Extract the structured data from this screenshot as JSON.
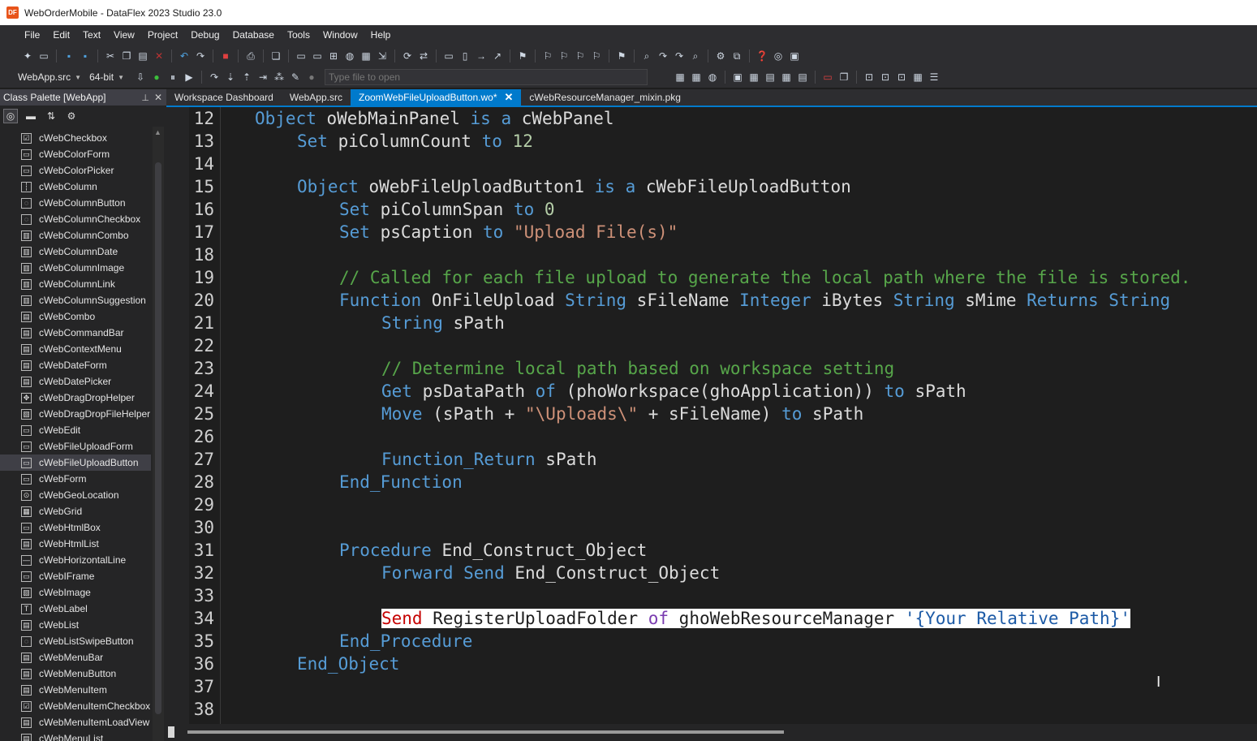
{
  "window": {
    "title": "WebOrderMobile - DataFlex 2023 Studio 23.0",
    "app_icon": "DF"
  },
  "menu": [
    "File",
    "Edit",
    "Text",
    "View",
    "Project",
    "Debug",
    "Database",
    "Tools",
    "Window",
    "Help"
  ],
  "toolbar": {
    "project_select": "WebApp.src",
    "bitness_select": "64-bit",
    "open_file_placeholder": "Type file to open"
  },
  "palette": {
    "title": "Class Palette [WebApp]",
    "selected": "cWebFileUploadButton",
    "items": [
      {
        "label": "cWebCheckbox",
        "icon": "checkbox-icon"
      },
      {
        "label": "cWebColorForm",
        "icon": "color-form-icon"
      },
      {
        "label": "cWebColorPicker",
        "icon": "color-picker-icon"
      },
      {
        "label": "cWebColumn",
        "icon": "column-icon"
      },
      {
        "label": "cWebColumnButton",
        "icon": "column-button-icon"
      },
      {
        "label": "cWebColumnCheckbox",
        "icon": "column-checkbox-icon"
      },
      {
        "label": "cWebColumnCombo",
        "icon": "column-combo-icon"
      },
      {
        "label": "cWebColumnDate",
        "icon": "column-date-icon"
      },
      {
        "label": "cWebColumnImage",
        "icon": "column-image-icon"
      },
      {
        "label": "cWebColumnLink",
        "icon": "column-link-icon"
      },
      {
        "label": "cWebColumnSuggestion",
        "icon": "column-suggestion-icon"
      },
      {
        "label": "cWebCombo",
        "icon": "combo-icon"
      },
      {
        "label": "cWebCommandBar",
        "icon": "commandbar-icon"
      },
      {
        "label": "cWebContextMenu",
        "icon": "context-menu-icon"
      },
      {
        "label": "cWebDateForm",
        "icon": "date-form-icon"
      },
      {
        "label": "cWebDatePicker",
        "icon": "date-picker-icon"
      },
      {
        "label": "cWebDragDropHelper",
        "icon": "drag-drop-icon"
      },
      {
        "label": "cWebDragDropFileHelper",
        "icon": "drag-drop-file-icon"
      },
      {
        "label": "cWebEdit",
        "icon": "edit-icon"
      },
      {
        "label": "cWebFileUploadForm",
        "icon": "file-upload-form-icon"
      },
      {
        "label": "cWebFileUploadButton",
        "icon": "file-upload-button-icon"
      },
      {
        "label": "cWebForm",
        "icon": "form-icon"
      },
      {
        "label": "cWebGeoLocation",
        "icon": "geolocation-icon"
      },
      {
        "label": "cWebGrid",
        "icon": "grid-icon"
      },
      {
        "label": "cWebHtmlBox",
        "icon": "htmlbox-icon"
      },
      {
        "label": "cWebHtmlList",
        "icon": "htmllist-icon"
      },
      {
        "label": "cWebHorizontalLine",
        "icon": "horizontal-line-icon"
      },
      {
        "label": "cWebIFrame",
        "icon": "iframe-icon"
      },
      {
        "label": "cWebImage",
        "icon": "image-icon"
      },
      {
        "label": "cWebLabel",
        "icon": "label-icon"
      },
      {
        "label": "cWebList",
        "icon": "list-icon"
      },
      {
        "label": "cWebListSwipeButton",
        "icon": "list-swipe-icon"
      },
      {
        "label": "cWebMenuBar",
        "icon": "menubar-icon"
      },
      {
        "label": "cWebMenuButton",
        "icon": "menu-button-icon"
      },
      {
        "label": "cWebMenuItem",
        "icon": "menu-item-icon"
      },
      {
        "label": "cWebMenuItemCheckbox",
        "icon": "menu-item-checkbox-icon"
      },
      {
        "label": "cWebMenuItemLoadView",
        "icon": "menu-item-loadview-icon"
      },
      {
        "label": "cWebMenuList",
        "icon": "menu-list-icon"
      }
    ]
  },
  "tabs": [
    {
      "label": "Workspace Dashboard",
      "active": false
    },
    {
      "label": "WebApp.src",
      "active": false
    },
    {
      "label": "ZoomWebFileUploadButton.wo*",
      "active": true
    },
    {
      "label": "cWebResourceManager_mixin.pkg",
      "active": false
    }
  ],
  "editor": {
    "lines": [
      {
        "n": "12",
        "indent": 1,
        "tokens": [
          [
            "kw",
            "Object"
          ],
          [
            "pl",
            " oWebMainPanel "
          ],
          [
            "kw",
            "is a"
          ],
          [
            "pl",
            " cWebPanel"
          ]
        ]
      },
      {
        "n": "13",
        "indent": 2,
        "tokens": [
          [
            "kw",
            "Set"
          ],
          [
            "pl",
            " piColumnCount "
          ],
          [
            "kw",
            "to"
          ],
          [
            "pl",
            " "
          ],
          [
            "nm",
            "12"
          ]
        ]
      },
      {
        "n": "14",
        "indent": 0,
        "tokens": []
      },
      {
        "n": "15",
        "indent": 2,
        "tokens": [
          [
            "kw",
            "Object"
          ],
          [
            "pl",
            " oWebFileUploadButton1 "
          ],
          [
            "kw",
            "is a"
          ],
          [
            "pl",
            " cWebFileUploadButton"
          ]
        ]
      },
      {
        "n": "16",
        "indent": 3,
        "tokens": [
          [
            "kw",
            "Set"
          ],
          [
            "pl",
            " piColumnSpan "
          ],
          [
            "kw",
            "to"
          ],
          [
            "pl",
            " "
          ],
          [
            "nm",
            "0"
          ]
        ]
      },
      {
        "n": "17",
        "indent": 3,
        "tokens": [
          [
            "kw",
            "Set"
          ],
          [
            "pl",
            " psCaption "
          ],
          [
            "kw",
            "to"
          ],
          [
            "pl",
            " "
          ],
          [
            "st",
            "\"Upload File(s)\""
          ]
        ]
      },
      {
        "n": "18",
        "indent": 0,
        "tokens": []
      },
      {
        "n": "19",
        "indent": 3,
        "tokens": [
          [
            "cm",
            "// Called for each file upload to generate the local path where the file is stored."
          ]
        ]
      },
      {
        "n": "20",
        "indent": 3,
        "tokens": [
          [
            "kw",
            "Function"
          ],
          [
            "pl",
            " OnFileUpload "
          ],
          [
            "kw",
            "String"
          ],
          [
            "pl",
            " sFileName "
          ],
          [
            "kw",
            "Integer"
          ],
          [
            "pl",
            " iBytes "
          ],
          [
            "kw",
            "String"
          ],
          [
            "pl",
            " sMime "
          ],
          [
            "kw",
            "Returns String"
          ]
        ]
      },
      {
        "n": "21",
        "indent": 4,
        "tokens": [
          [
            "kw",
            "String"
          ],
          [
            "pl",
            " sPath"
          ]
        ]
      },
      {
        "n": "22",
        "indent": 0,
        "tokens": []
      },
      {
        "n": "23",
        "indent": 4,
        "tokens": [
          [
            "cm",
            "// Determine local path based on workspace setting"
          ]
        ]
      },
      {
        "n": "24",
        "indent": 4,
        "tokens": [
          [
            "kw",
            "Get"
          ],
          [
            "pl",
            " psDataPath "
          ],
          [
            "kw",
            "of"
          ],
          [
            "pl",
            " (phoWorkspace(ghoApplication)) "
          ],
          [
            "kw",
            "to"
          ],
          [
            "pl",
            " sPath"
          ]
        ]
      },
      {
        "n": "25",
        "indent": 4,
        "tokens": [
          [
            "kw",
            "Move"
          ],
          [
            "pl",
            " (sPath + "
          ],
          [
            "st",
            "\"\\Uploads\\\""
          ],
          [
            "pl",
            " + sFileName) "
          ],
          [
            "kw",
            "to"
          ],
          [
            "pl",
            " sPath"
          ]
        ]
      },
      {
        "n": "26",
        "indent": 0,
        "tokens": []
      },
      {
        "n": "27",
        "indent": 4,
        "tokens": [
          [
            "kw",
            "Function_Return"
          ],
          [
            "pl",
            " sPath"
          ]
        ]
      },
      {
        "n": "28",
        "indent": 3,
        "tokens": [
          [
            "kw",
            "End_Function"
          ]
        ]
      },
      {
        "n": "29",
        "indent": 0,
        "tokens": []
      },
      {
        "n": "30",
        "indent": 0,
        "tokens": []
      },
      {
        "n": "31",
        "indent": 3,
        "tokens": [
          [
            "kw",
            "Procedure"
          ],
          [
            "pl",
            " End_Construct_Object"
          ]
        ]
      },
      {
        "n": "32",
        "indent": 4,
        "tokens": [
          [
            "kw",
            "Forward Send"
          ],
          [
            "pl",
            " End_Construct_Object"
          ]
        ]
      },
      {
        "n": "33",
        "indent": 0,
        "tokens": []
      },
      {
        "n": "34",
        "indent": 4,
        "highlight": true,
        "tokens": [
          [
            "hkw",
            "Send"
          ],
          [
            "hpl",
            " RegisterUploadFolder "
          ],
          [
            "hkw2",
            "of"
          ],
          [
            "hpl",
            " ghoWebResourceManager "
          ],
          [
            "hst",
            "'{Your Relative Path}'"
          ]
        ]
      },
      {
        "n": "35",
        "indent": 3,
        "tokens": [
          [
            "kw",
            "End_Procedure"
          ]
        ]
      },
      {
        "n": "36",
        "indent": 2,
        "tokens": [
          [
            "kw",
            "End_Object"
          ]
        ]
      },
      {
        "n": "37",
        "indent": 0,
        "tokens": []
      },
      {
        "n": "38",
        "indent": 0,
        "tokens": []
      }
    ]
  }
}
